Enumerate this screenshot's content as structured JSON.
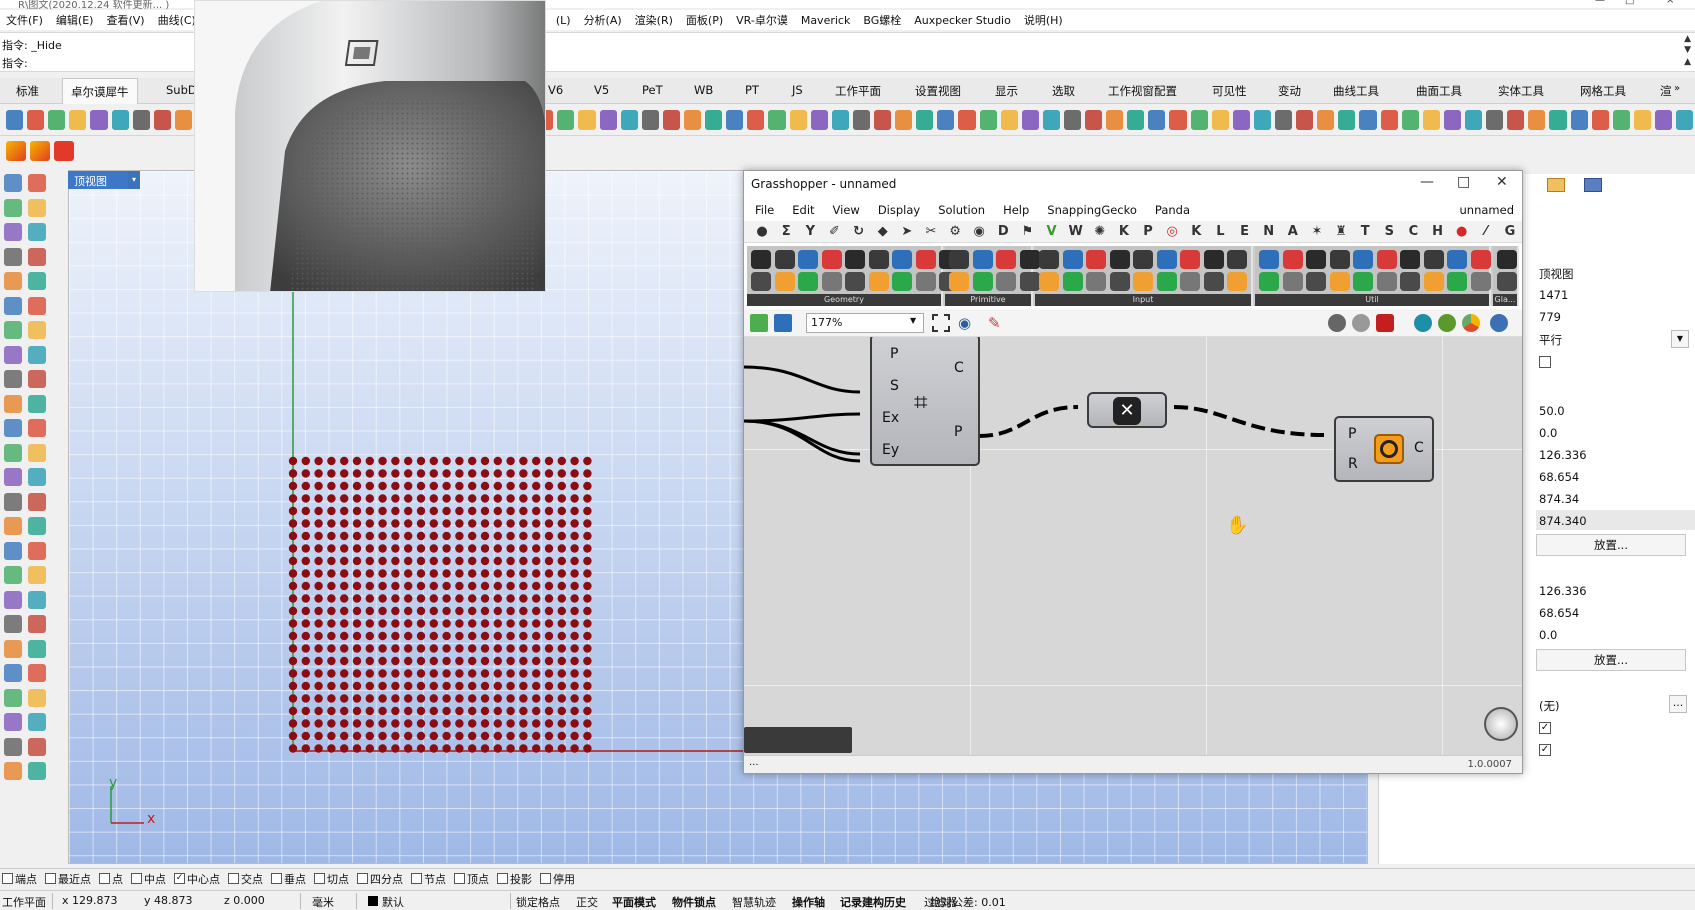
{
  "window": {
    "title": "R\\图文(2020.12.24 软件更新... )",
    "controls": [
      "—",
      "□",
      "×"
    ]
  },
  "menubar": {
    "items": [
      "文件(F)",
      "编辑(E)",
      "查看(V)",
      "曲线(C)",
      "(L)",
      "分析(A)",
      "渲染(R)",
      "面板(P)",
      "VR-卓尔谟",
      "Maverick",
      "BG螺栓",
      "Auxpecker Studio",
      "说明(H)"
    ]
  },
  "command": {
    "history": "指令: _Hide",
    "prompt": "指令:"
  },
  "tabs": {
    "items": [
      "标准",
      "卓尔谟犀牛",
      "SubD",
      "V6",
      "V5",
      "PeT",
      "WB",
      "PT",
      "JS",
      "工作平面",
      "设置视图",
      "显示",
      "选取",
      "工作视窗配置",
      "可见性",
      "变动",
      "曲线工具",
      "曲面工具",
      "实体工具",
      "网格工具",
      "渲"
    ],
    "active_index": 1
  },
  "viewport": {
    "label": "顶视图",
    "axis_x": "x",
    "axis_y": "y"
  },
  "grasshopper": {
    "title": "Grasshopper - unnamed",
    "menu": [
      "File",
      "Edit",
      "View",
      "Display",
      "Solution",
      "Help",
      "SnappingGecko",
      "Panda"
    ],
    "document_name": "unnamed",
    "categories": [
      "●",
      "Σ",
      "Y",
      "✐",
      "↻",
      "◆",
      "➤",
      "✂",
      "⚙",
      "◉",
      "D",
      "⚑",
      "V",
      "W",
      "✺",
      "K",
      "P",
      "◎",
      "K",
      "L",
      "E",
      "N",
      "A",
      "✶",
      "♜",
      "T",
      "S",
      "C",
      "H",
      "●",
      "⁄",
      "G"
    ],
    "ribbon_groups": [
      "Geometry",
      "Primitive",
      "Input",
      "Util",
      "Gla..."
    ],
    "zoom": "177%",
    "status_left": "...",
    "version": "1.0.0007",
    "components": {
      "grid": {
        "inputs": [
          "P",
          "S",
          "Ex",
          "Ey"
        ],
        "outputs": [
          "C",
          "P"
        ]
      },
      "circle": {
        "inputs": [
          "P",
          "R"
        ],
        "outputs": [
          "C"
        ]
      }
    }
  },
  "properties": {
    "view_name": "顶视图",
    "width": "1471",
    "height": "779",
    "projection": "平行",
    "v1": "50.0",
    "v2": "0.0",
    "v3": "126.336",
    "v4": "68.654",
    "v5": "874.34",
    "v6": "874.340",
    "place_button_1": "放置...",
    "t1": "126.336",
    "t2": "68.654",
    "t3": "0.0",
    "place_button_2": "放置...",
    "wallpaper": "(无)",
    "browse": "..."
  },
  "osnap": {
    "items": [
      {
        "label": "端点",
        "checked": false
      },
      {
        "label": "最近点",
        "checked": false
      },
      {
        "label": "点",
        "checked": false
      },
      {
        "label": "中点",
        "checked": false
      },
      {
        "label": "中心点",
        "checked": true
      },
      {
        "label": "交点",
        "checked": false
      },
      {
        "label": "垂点",
        "checked": false
      },
      {
        "label": "切点",
        "checked": false
      },
      {
        "label": "四分点",
        "checked": false
      },
      {
        "label": "节点",
        "checked": false
      },
      {
        "label": "顶点",
        "checked": false
      },
      {
        "label": "投影",
        "checked": false
      },
      {
        "label": "停用",
        "checked": false
      }
    ]
  },
  "status": {
    "cplane": "工作平面",
    "x": "x 129.873",
    "y": "y 48.873",
    "z": "z 0.000",
    "unit": "毫米",
    "layer": "默认",
    "toggles": [
      "锁定格点",
      "正交",
      "平面模式",
      "物件锁点",
      "智慧轨迹",
      "操作轴",
      "记录建构历史",
      "过滤器"
    ],
    "tolerance": "绝对公差: 0.01"
  },
  "colors": {
    "accent": "#3d78c8",
    "point_fill": "#8b0d12",
    "gh_canvas": "#d7d7d7",
    "wire": "#000000"
  }
}
